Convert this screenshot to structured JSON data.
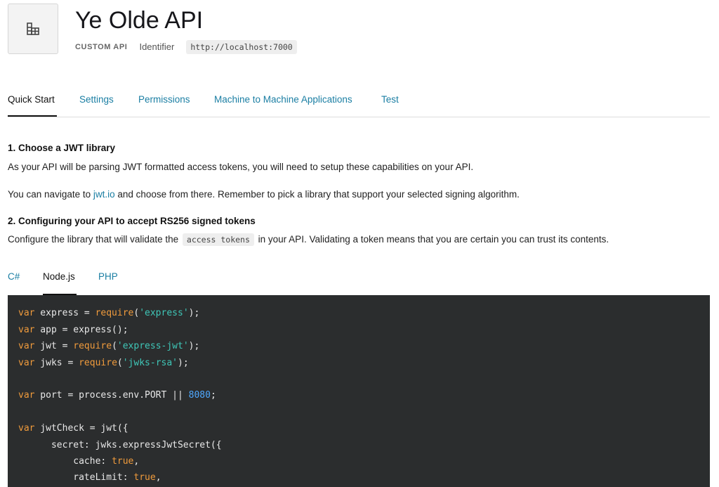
{
  "header": {
    "icon": "building-icon",
    "title": "Ye Olde API",
    "type_label": "CUSTOM API",
    "identifier_label": "Identifier",
    "identifier_value": "http://localhost:7000"
  },
  "tabs": [
    {
      "label": "Quick Start",
      "active": true
    },
    {
      "label": "Settings",
      "active": false
    },
    {
      "label": "Permissions",
      "active": false
    },
    {
      "label": "Machine to Machine Applications",
      "active": false
    },
    {
      "label": "Test",
      "active": false
    }
  ],
  "step1": {
    "heading": "1. Choose a JWT library",
    "para1": "As your API will be parsing JWT formatted access tokens, you will need to setup these capabilities on your API.",
    "para2_before": "You can navigate to ",
    "para2_link": "jwt.io",
    "para2_after": " and choose from there. Remember to pick a library that support your selected signing algorithm."
  },
  "step2": {
    "heading": "2. Configuring your API to accept RS256 signed tokens",
    "para_before": "Configure the library that will validate the ",
    "para_code": "access tokens",
    "para_after": " in your API. Validating a token means that you are certain you can trust its contents."
  },
  "code_tabs": [
    {
      "label": "C#",
      "active": false
    },
    {
      "label": "Node.js",
      "active": true
    },
    {
      "label": "PHP",
      "active": false
    }
  ],
  "code": {
    "l1": {
      "kw": "var",
      "a": " express = ",
      "fn": "require",
      "b": "(",
      "str": "'express'",
      "c": ");"
    },
    "l2": {
      "kw": "var",
      "a": " app = express();"
    },
    "l3": {
      "kw": "var",
      "a": " jwt = ",
      "fn": "require",
      "b": "(",
      "str": "'express-jwt'",
      "c": ");"
    },
    "l4": {
      "kw": "var",
      "a": " jwks = ",
      "fn": "require",
      "b": "(",
      "str": "'jwks-rsa'",
      "c": ");"
    },
    "l5": {
      "kw": "var",
      "a": " port = process.env.PORT || ",
      "num": "8080",
      "c": ";"
    },
    "l6": {
      "kw": "var",
      "a": " jwtCheck = jwt({"
    },
    "l7": {
      "a": "      secret: jwks.expressJwtSecret({"
    },
    "l8": {
      "a": "          cache: ",
      "bool": "true",
      "c": ","
    },
    "l9": {
      "a": "          rateLimit: ",
      "bool": "true",
      "c": ","
    }
  }
}
